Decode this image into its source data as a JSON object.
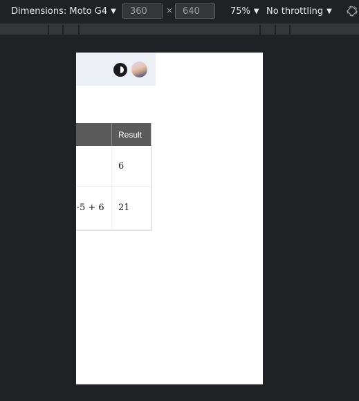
{
  "devtools_toolbar": {
    "dimensions_label": "Dimensions: Moto G4",
    "width_value": "360",
    "times_symbol": "×",
    "height_value": "640",
    "zoom_value": "75%",
    "throttling_value": "No throttling",
    "caret": "▼",
    "rotate_icon": "rotate-icon"
  },
  "page": {
    "header": {
      "theme_toggle_icon": "contrast-icon",
      "avatar": "user-avatar"
    },
    "table": {
      "headers": [
        "",
        "Result"
      ],
      "rows": [
        {
          "expression": "",
          "result": "6"
        },
        {
          "expression": "5 + 6",
          "result": "21"
        }
      ],
      "truncated_prefix": "+"
    }
  }
}
